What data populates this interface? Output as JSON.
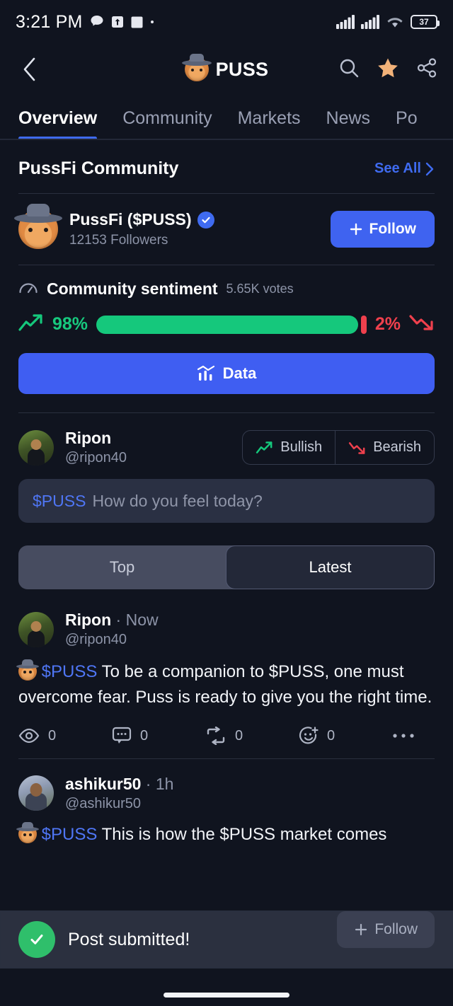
{
  "status_bar": {
    "time": "3:21 PM",
    "battery_percent": "37",
    "icons": [
      "chat-bubble-icon",
      "upload-arrow-icon",
      "square-icon",
      "dot-icon",
      "signal-bars-icon",
      "signal-bars-icon",
      "wifi-icon",
      "battery-icon"
    ]
  },
  "header": {
    "title": "PUSS",
    "back_icon": "chevron-left-icon",
    "actions": [
      "search-icon",
      "star-icon",
      "share-icon"
    ],
    "star_color": "#f2b279"
  },
  "tabs": [
    {
      "label": "Overview",
      "active": true
    },
    {
      "label": "Community",
      "active": false
    },
    {
      "label": "Markets",
      "active": false
    },
    {
      "label": "News",
      "active": false
    },
    {
      "label": "Po",
      "active": false
    }
  ],
  "section": {
    "title": "PussFi Community",
    "see_all": "See All"
  },
  "community_profile": {
    "name": "PussFi ($PUSS)",
    "verified": true,
    "followers": "12153 Followers",
    "follow_label": "Follow"
  },
  "sentiment": {
    "title": "Community sentiment",
    "votes": "5.65K votes",
    "bullish_pct": "98%",
    "bearish_pct": "2%",
    "bullish_value": 98,
    "bearish_value": 2,
    "bullish_color": "#15c87c",
    "bearish_color": "#ef404d",
    "data_button": "Data"
  },
  "composer": {
    "user_name": "Ripon",
    "user_handle": "@ripon40",
    "bullish_label": "Bullish",
    "bearish_label": "Bearish",
    "ticker": "$PUSS",
    "placeholder": "How do you feel today?"
  },
  "feed_filter": {
    "options": [
      {
        "label": "Top",
        "active": false
      },
      {
        "label": "Latest",
        "active": true
      }
    ]
  },
  "posts": [
    {
      "author": "Ripon",
      "handle": "@ripon40",
      "time": "Now",
      "ticker": "$PUSS",
      "text": "To be a companion to $PUSS, one must overcome fear.  Puss is ready to give you the right time.",
      "actions": [
        {
          "icon": "eye-icon",
          "count": "0"
        },
        {
          "icon": "comment-icon",
          "count": "0"
        },
        {
          "icon": "repost-icon",
          "count": "0"
        },
        {
          "icon": "add-reaction-icon",
          "count": "0"
        },
        {
          "icon": "more-horizontal-icon",
          "count": ""
        }
      ]
    },
    {
      "author": "ashikur50",
      "handle": "@ashikur50",
      "time": "1h",
      "ticker": "$PUSS",
      "text": "This is how the $PUSS market comes",
      "follow_label": "Follow"
    }
  ],
  "toast": {
    "message": "Post submitted!",
    "icon": "check-circle-icon",
    "icon_color": "#2fbf6b"
  }
}
